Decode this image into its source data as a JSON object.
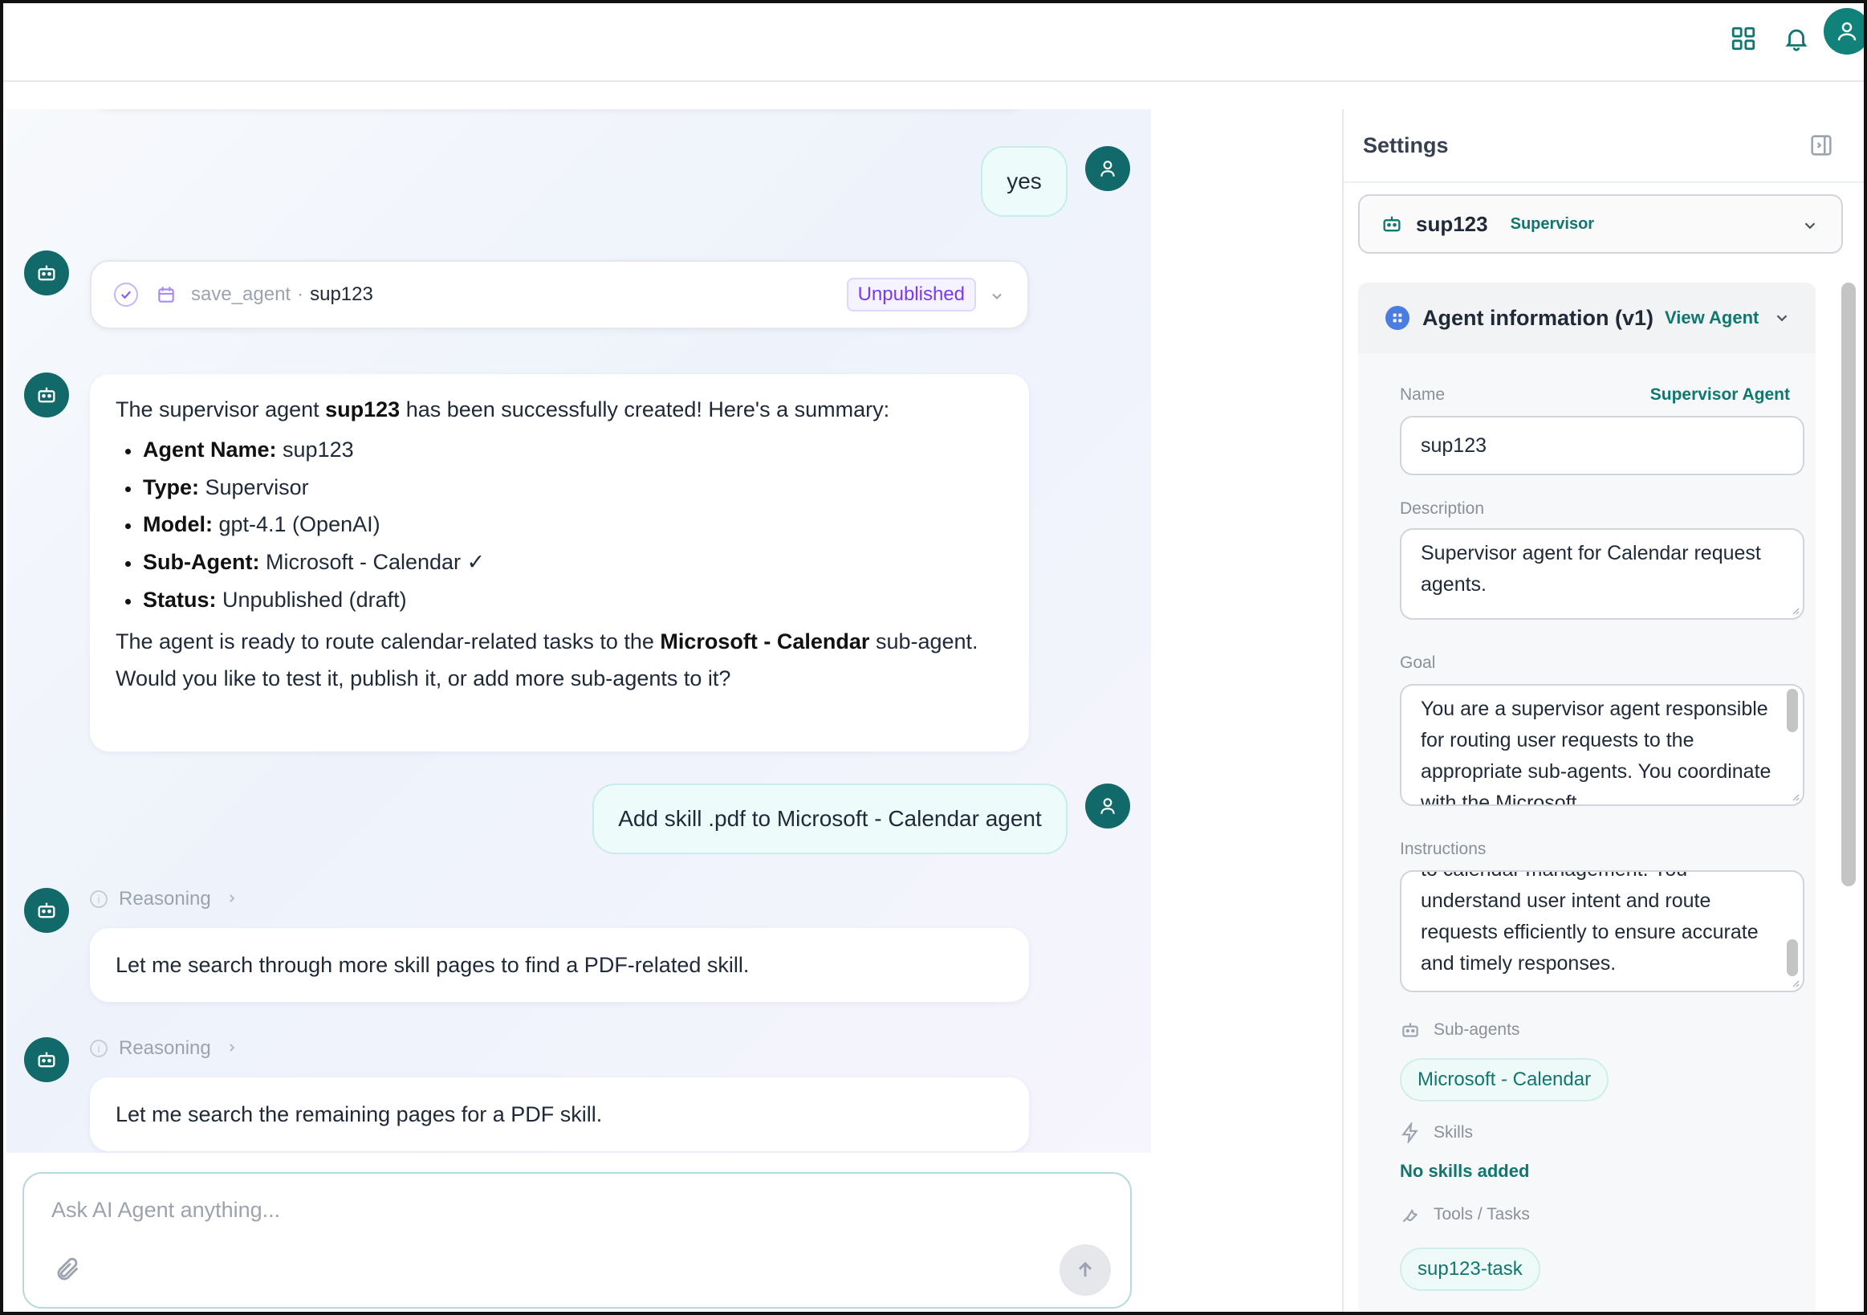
{
  "topbar": {
    "icons": [
      "apps-grid-icon",
      "bell-icon",
      "user-avatar-icon"
    ]
  },
  "chat": {
    "messages": {
      "user_yes": "yes",
      "tool": {
        "name": "save_agent",
        "separator": "·",
        "agent": "sup123",
        "badge": "Unpublished"
      },
      "summary": {
        "intro_pre": "The supervisor agent ",
        "intro_name": "sup123",
        "intro_post": " has been successfully created! Here's a summary:",
        "items": [
          {
            "label": "Agent Name:",
            "value": " sup123"
          },
          {
            "label": "Type:",
            "value": " Supervisor"
          },
          {
            "label": "Model:",
            "value": " gpt-4.1 (OpenAI)"
          },
          {
            "label": "Sub-Agent:",
            "value": " Microsoft - Calendar ✓"
          },
          {
            "label": "Status:",
            "value": " Unpublished (draft)"
          }
        ],
        "outro_pre": "The agent is ready to route calendar-related tasks to the ",
        "outro_bold": "Microsoft - Calendar",
        "outro_post": " sub-agent. Would you like to test it, publish it, or add more sub-agents to it?"
      },
      "user_add_skill": "Add skill .pdf to Microsoft - Calendar agent",
      "reasoning_label": "Reasoning",
      "reasoning_1": "Let me search through more skill pages to find a PDF-related skill.",
      "reasoning_2": "Let me search the remaining pages for a PDF skill."
    },
    "input": {
      "placeholder": "Ask AI Agent anything..."
    }
  },
  "settings": {
    "title": "Settings",
    "agent_select": {
      "name": "sup123",
      "type": "Supervisor"
    },
    "info": {
      "title": "Agent information (v1)",
      "view_link": "View Agent",
      "name_label": "Name",
      "name_type": "Supervisor Agent",
      "name_value": "sup123",
      "description_label": "Description",
      "description_value": "Supervisor agent for Calendar request agents.",
      "goal_label": "Goal",
      "goal_value": "You are a supervisor agent responsible for routing user requests to the appropriate sub-agents. You coordinate with the Microsoft",
      "instructions_label": "Instructions",
      "instructions_value": "to calendar management. You understand user intent and route requests efficiently to ensure accurate and timely responses.",
      "subagents_label": "Sub-agents",
      "subagent_chip": "Microsoft - Calendar",
      "skills_label": "Skills",
      "skills_empty": "No skills added",
      "tools_label": "Tools / Tasks",
      "tool_chip": "sup123-task"
    }
  },
  "colors": {
    "teal": "#11766f",
    "avatar": "#12696a",
    "purple_badge": "#7c3aed"
  }
}
